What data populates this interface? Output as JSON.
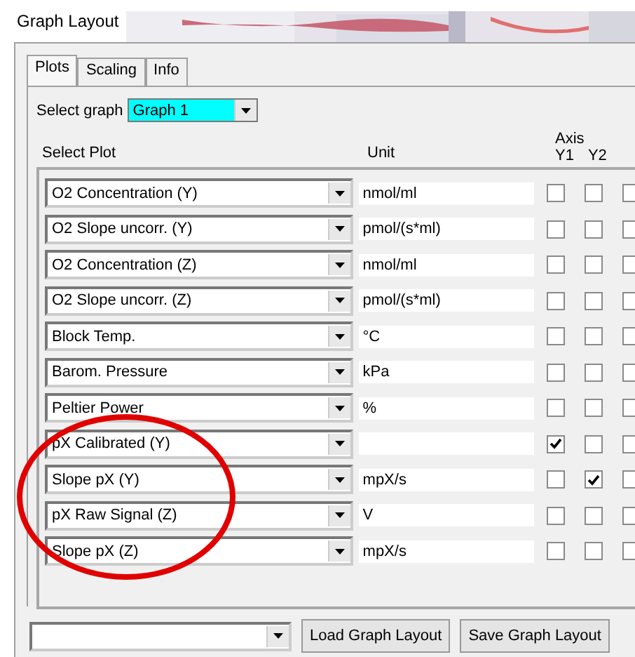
{
  "window": {
    "title": "Graph Layout"
  },
  "tabs": [
    {
      "label": "Plots",
      "selected": true
    },
    {
      "label": "Scaling",
      "selected": false
    },
    {
      "label": "Info",
      "selected": false
    }
  ],
  "select_graph": {
    "label": "Select graph",
    "value": "Graph 1"
  },
  "columns": {
    "plot": "Select Plot",
    "unit": "Unit",
    "axis": "Axis",
    "y1": "Y1",
    "y2": "Y2"
  },
  "rows": [
    {
      "plot": "O2 Concentration (Y)",
      "unit": "nmol/ml",
      "checks": [
        false,
        false,
        false
      ]
    },
    {
      "plot": "O2 Slope uncorr. (Y)",
      "unit": "pmol/(s*ml)",
      "checks": [
        false,
        false,
        false
      ]
    },
    {
      "plot": "O2 Concentration (Z)",
      "unit": "nmol/ml",
      "checks": [
        false,
        false,
        false
      ]
    },
    {
      "plot": "O2 Slope uncorr. (Z)",
      "unit": "pmol/(s*ml)",
      "checks": [
        false,
        false,
        false
      ]
    },
    {
      "plot": "Block Temp.",
      "unit": "°C",
      "checks": [
        false,
        false,
        false
      ]
    },
    {
      "plot": "Barom. Pressure",
      "unit": "kPa",
      "checks": [
        false,
        false,
        false
      ]
    },
    {
      "plot": "Peltier Power",
      "unit": "%",
      "checks": [
        false,
        false,
        false
      ]
    },
    {
      "plot": "pX Calibrated (Y)",
      "checks": [
        true,
        false,
        false
      ]
    },
    {
      "plot": "Slope pX (Y)",
      "unit": "mpX/s",
      "checks": [
        false,
        true,
        false
      ]
    },
    {
      "plot": "pX Raw Signal (Z)",
      "unit": "V",
      "checks": [
        false,
        false,
        false
      ]
    },
    {
      "plot": "Slope pX (Z)",
      "unit": "mpX/s",
      "checks": [
        false,
        false,
        false
      ]
    }
  ],
  "buttons": [
    "Load Graph Layout",
    "Save Graph Layout"
  ]
}
